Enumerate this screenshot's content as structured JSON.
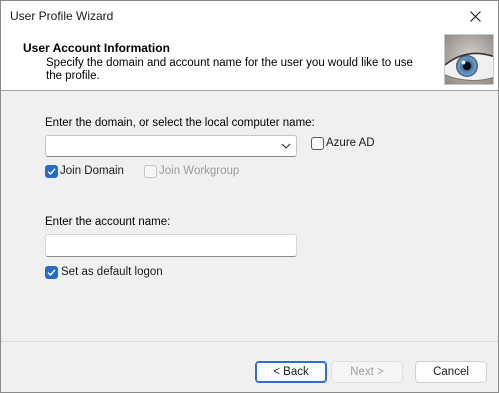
{
  "window": {
    "title": "User Profile Wizard"
  },
  "header": {
    "title": "User Account Information",
    "description": "Specify the domain and account name for the user you would like to use the profile.",
    "image": "eye-image"
  },
  "form": {
    "domain_label": "Enter the domain, or select the local computer name:",
    "domain_value": "",
    "azure_ad_label": "Azure AD",
    "azure_ad_checked": false,
    "join_domain_label": "Join Domain",
    "join_domain_checked": true,
    "join_workgroup_label": "Join Workgroup",
    "join_workgroup_checked": false,
    "account_label": "Enter the account name:",
    "account_value": "",
    "default_logon_label": "Set as default logon",
    "default_logon_checked": true
  },
  "footer": {
    "back_label": "< Back",
    "next_label": "Next >",
    "cancel_label": "Cancel"
  },
  "colors": {
    "accent": "#2a6bc8",
    "disabled_text": "#9a9a9a"
  }
}
